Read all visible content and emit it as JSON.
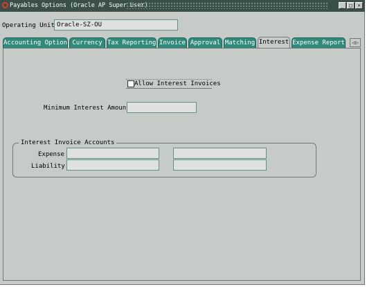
{
  "window": {
    "title": "Payables Options (Oracle AP Super User)",
    "controls": {
      "minimize": "_",
      "maximize": "□",
      "close": "×"
    }
  },
  "header": {
    "operating_unit_label": "Operating Unit",
    "operating_unit_value": "Oracle-SZ-OU"
  },
  "tabs": [
    {
      "label": "Accounting Option"
    },
    {
      "label": "Currency"
    },
    {
      "label": "Tax Reporting"
    },
    {
      "label": "Invoice"
    },
    {
      "label": "Approval"
    },
    {
      "label": "Matching"
    },
    {
      "label": "Interest",
      "active": true
    },
    {
      "label": "Expense Report"
    }
  ],
  "tab_scroll": "◁▷",
  "interest": {
    "allow_interest_invoices_label": "Allow Interest Invoices",
    "allow_interest_invoices_checked": false,
    "minimum_interest_amount_label": "Minimum Interest Amount",
    "minimum_interest_amount_value": "",
    "accounts_group_title": "Interest Invoice Accounts",
    "expense_label": "Expense",
    "liability_label": "Liability",
    "expense_value_1": "",
    "expense_value_2": "",
    "liability_value_1": "",
    "liability_value_2": ""
  },
  "colors": {
    "title_bar": "#3b4f49",
    "tab_inactive": "#2f8a7c",
    "window_bg": "#c7cbc8"
  }
}
